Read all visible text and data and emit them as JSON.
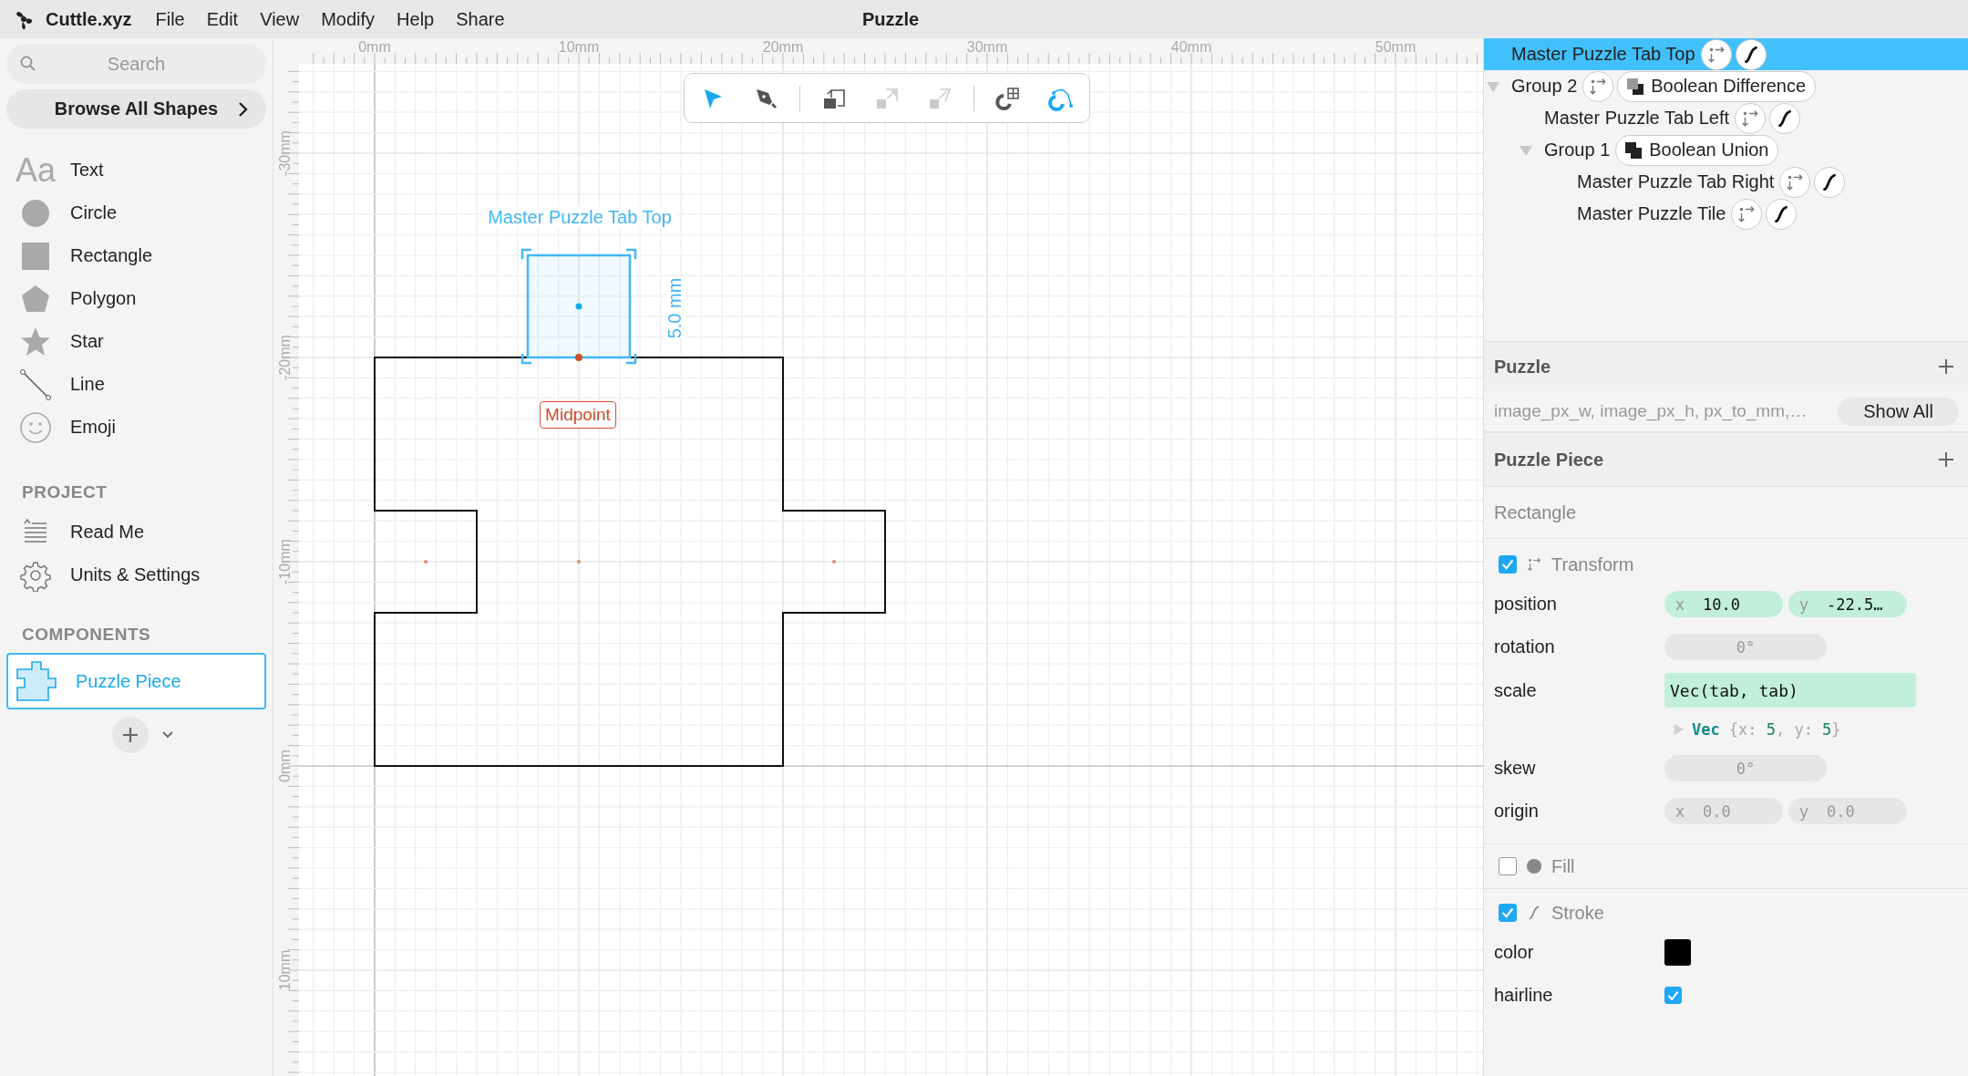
{
  "app": {
    "name": "Cuttle.xyz",
    "menu": [
      "File",
      "Edit",
      "View",
      "Modify",
      "Help",
      "Share"
    ],
    "document_title": "Puzzle"
  },
  "sidebar": {
    "search": {
      "placeholder": "Search"
    },
    "browse_button": "Browse All Shapes",
    "shapes": [
      {
        "kind": "text",
        "glyph": "Aa",
        "label": "Text"
      },
      {
        "kind": "circle",
        "label": "Circle"
      },
      {
        "kind": "rectangle",
        "label": "Rectangle"
      },
      {
        "kind": "polygon",
        "label": "Polygon"
      },
      {
        "kind": "star",
        "label": "Star"
      },
      {
        "kind": "line",
        "label": "Line"
      },
      {
        "kind": "emoji",
        "label": "Emoji"
      }
    ],
    "project": {
      "heading": "PROJECT",
      "items": [
        {
          "kind": "readme",
          "label": "Read Me"
        },
        {
          "kind": "settings",
          "label": "Units & Settings"
        }
      ]
    },
    "components": {
      "heading": "COMPONENTS",
      "items": [
        {
          "label": "Puzzle Piece",
          "selected": true
        }
      ]
    }
  },
  "canvas": {
    "ruler_x": [
      "0mm",
      "10mm",
      "20mm",
      "30mm",
      "40mm",
      "50mm"
    ],
    "ruler_y": [
      "-30mm",
      "-20mm",
      "-10mm",
      "0mm",
      "10mm"
    ],
    "tools": [
      {
        "kind": "select",
        "selected": true,
        "disabled": false
      },
      {
        "kind": "pen",
        "selected": false,
        "disabled": false
      },
      {
        "kind": "divider"
      },
      {
        "kind": "rotate",
        "selected": false,
        "disabled": false
      },
      {
        "kind": "scale",
        "selected": false,
        "disabled": true
      },
      {
        "kind": "skew",
        "selected": false,
        "disabled": true
      },
      {
        "kind": "divider"
      },
      {
        "kind": "snap-grid",
        "selected": false,
        "disabled": false
      },
      {
        "kind": "snap-geometry",
        "selected": true,
        "disabled": false
      }
    ],
    "selection_label": "Master Puzzle Tab Top",
    "dimension_label": "5.0 mm",
    "snap_label": "Midpoint"
  },
  "layers": [
    {
      "name": "Master Puzzle Tab Top",
      "selected": true,
      "badges": [
        {
          "kind": "transform"
        },
        {
          "kind": "stroke"
        }
      ]
    },
    {
      "name": "Group 2",
      "selected": false,
      "expanded": true,
      "badges": [
        {
          "kind": "transform"
        },
        {
          "kind": "difference",
          "label": "Boolean Difference"
        }
      ],
      "children": [
        {
          "name": "Master Puzzle Tab Left",
          "selected": false,
          "badges": [
            {
              "kind": "transform"
            },
            {
              "kind": "stroke"
            }
          ]
        },
        {
          "name": "Group 1",
          "selected": false,
          "expanded": true,
          "badges": [
            {
              "kind": "union",
              "label": "Boolean Union"
            }
          ],
          "children": [
            {
              "name": "Master Puzzle Tab Right",
              "selected": false,
              "badges": [
                {
                  "kind": "transform"
                },
                {
                  "kind": "stroke"
                }
              ]
            },
            {
              "name": "Master Puzzle Tile",
              "selected": false,
              "badges": [
                {
                  "kind": "transform"
                },
                {
                  "kind": "stroke"
                }
              ]
            }
          ]
        }
      ]
    }
  ],
  "parameters": {
    "title": "Puzzle",
    "summary": "image_px_w, image_px_h, px_to_mm,…",
    "show_all": "Show All"
  },
  "inspector": {
    "component": "Puzzle Piece",
    "shape": "Rectangle",
    "transform": {
      "label": "Transform",
      "checked": true,
      "properties": [
        {
          "label": "position",
          "kind": "pair",
          "fields": [
            {
              "axis": "x",
              "value": "10.0",
              "bound": true
            },
            {
              "axis": "y",
              "value": "-22.5…",
              "bound": true
            }
          ]
        },
        {
          "label": "rotation",
          "kind": "single",
          "value": "0°",
          "bound": false
        },
        {
          "label": "scale",
          "kind": "expression",
          "value": "Vec(tab, tab)",
          "bound": true,
          "result": [
            {
              "text": "Vec",
              "kind": "type"
            },
            {
              "text": "{x: ",
              "kind": "punct"
            },
            {
              "text": "5",
              "kind": "number"
            },
            {
              "text": ", y: ",
              "kind": "punct"
            },
            {
              "text": "5",
              "kind": "number"
            },
            {
              "text": "}",
              "kind": "punct"
            }
          ]
        },
        {
          "label": "skew",
          "kind": "single",
          "value": "0°",
          "bound": false
        },
        {
          "label": "origin",
          "kind": "pair",
          "fields": [
            {
              "axis": "x",
              "value": "0.0",
              "bound": false
            },
            {
              "axis": "y",
              "value": "0.0",
              "bound": false
            }
          ]
        }
      ]
    },
    "fill": {
      "label": "Fill",
      "checked": false
    },
    "stroke": {
      "label": "Stroke",
      "checked": true,
      "properties": [
        {
          "label": "color",
          "kind": "color",
          "color": "#000000"
        },
        {
          "label": "hairline",
          "kind": "checkbox",
          "checked": true
        }
      ]
    }
  }
}
